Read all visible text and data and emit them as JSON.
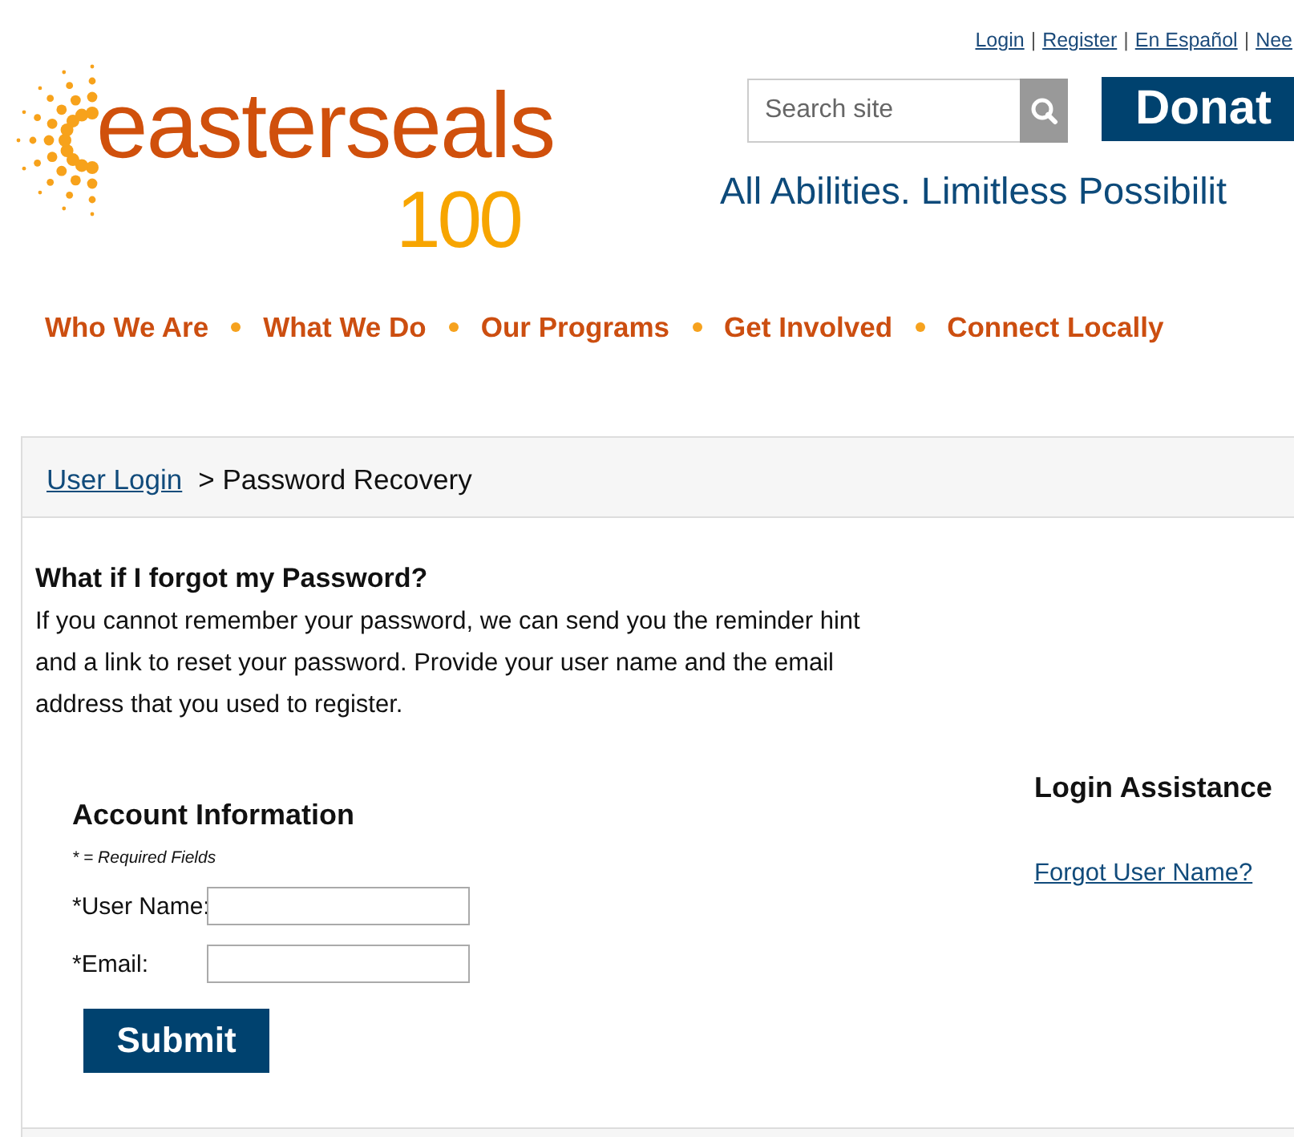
{
  "logo": {
    "wordmark": "easterseals",
    "anniversary": "100"
  },
  "top_links": [
    {
      "kind": "link",
      "text": "Login"
    },
    {
      "kind": "separator",
      "text": "|"
    },
    {
      "kind": "link",
      "text": "Register"
    },
    {
      "kind": "separator",
      "text": "|"
    },
    {
      "kind": "link",
      "text": "En Español"
    },
    {
      "kind": "separator",
      "text": "|"
    },
    {
      "kind": "link",
      "text": "Nee"
    }
  ],
  "search": {
    "placeholder": "Search site"
  },
  "donate_button": "Donat",
  "tagline": "All Abilities. Limitless Possibilit",
  "nav": [
    "Who We Are",
    "What We Do",
    "Our Programs",
    "Get Involved",
    "Connect Locally"
  ],
  "breadcrumb": {
    "link": "User Login",
    "current": "> Password Recovery"
  },
  "intro": {
    "heading": "What if I forgot my Password?",
    "text": "If you cannot remember your password, we can send you the reminder hint and a link to reset your password. Provide your user name and the email address that you used to register."
  },
  "account": {
    "heading": "Account Information",
    "note": "* = Required Fields",
    "fields": [
      {
        "label": "*User Name:"
      },
      {
        "label": "*Email:"
      }
    ],
    "submit": "Submit"
  },
  "assistance": {
    "heading": "Login Assistance",
    "link": "Forgot User Name?"
  }
}
